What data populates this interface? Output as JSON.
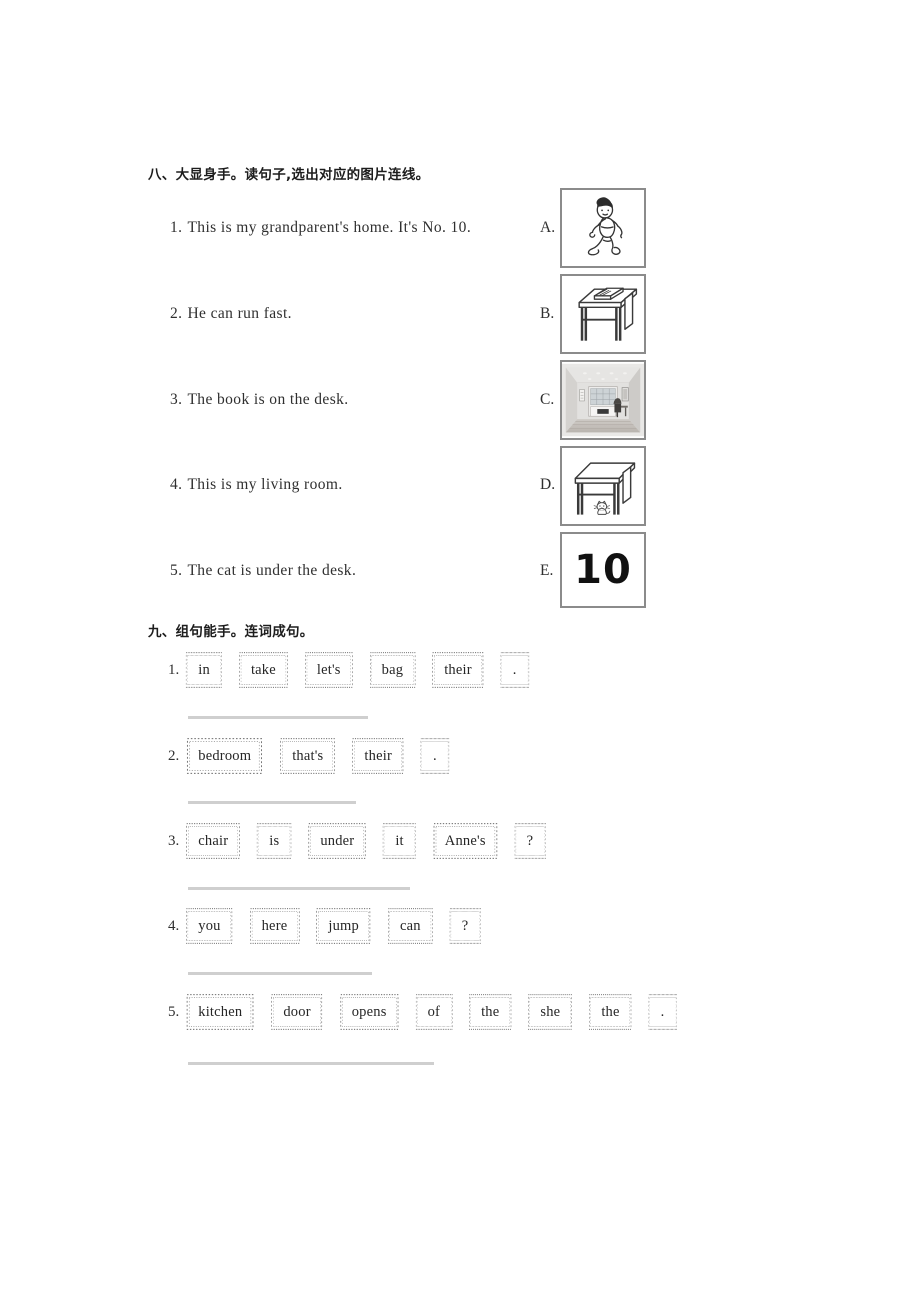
{
  "sections": [
    {
      "id": "section-eight",
      "heading": "八、大显身手。读句子,选出对应的图片连线。",
      "sentences": [
        {
          "num": "1.",
          "text": "This is my grandparent's home. It's No. 10."
        },
        {
          "num": "2.",
          "text": "He can run fast."
        },
        {
          "num": "3.",
          "text": "The book is on the desk."
        },
        {
          "num": "4.",
          "text": "This is my living room."
        },
        {
          "num": "5.",
          "text": "The cat is under the desk."
        }
      ],
      "options": [
        {
          "letter": "A.",
          "picture": "boy-running-icon",
          "alt": "A boy running fast"
        },
        {
          "letter": "B.",
          "picture": "book-on-desk-icon",
          "alt": "An open book on top of a desk"
        },
        {
          "letter": "C.",
          "picture": "living-room-photo",
          "alt": "Photograph of a living room with cabinets and fireplace"
        },
        {
          "letter": "D.",
          "picture": "cat-under-desk-icon",
          "alt": "A cat sitting under a desk"
        },
        {
          "letter": "E.",
          "picture": "number-ten",
          "alt": "The number 10",
          "value": "10"
        }
      ]
    },
    {
      "id": "section-nine",
      "heading": "九、组句能手。连词成句。",
      "rows": [
        {
          "num": "1.",
          "cards": [
            "in",
            "take",
            "let's",
            "bag",
            "their",
            "."
          ]
        },
        {
          "num": "2.",
          "cards": [
            "bedroom",
            "that's",
            "their",
            "."
          ]
        },
        {
          "num": "3.",
          "cards": [
            "chair",
            "is",
            "under",
            "it",
            "Anne's",
            "?"
          ]
        },
        {
          "num": "4.",
          "cards": [
            "you",
            "here",
            "jump",
            "can",
            "?"
          ]
        },
        {
          "num": "5.",
          "cards": [
            "kitchen",
            "door",
            "opens",
            "of",
            "the",
            "she",
            "the",
            "."
          ]
        }
      ]
    }
  ],
  "colors": {
    "ink": "#2b2b2b",
    "rule": "#cfcfcf",
    "box_border": "#8b8b8b",
    "page": "#ffffff"
  }
}
